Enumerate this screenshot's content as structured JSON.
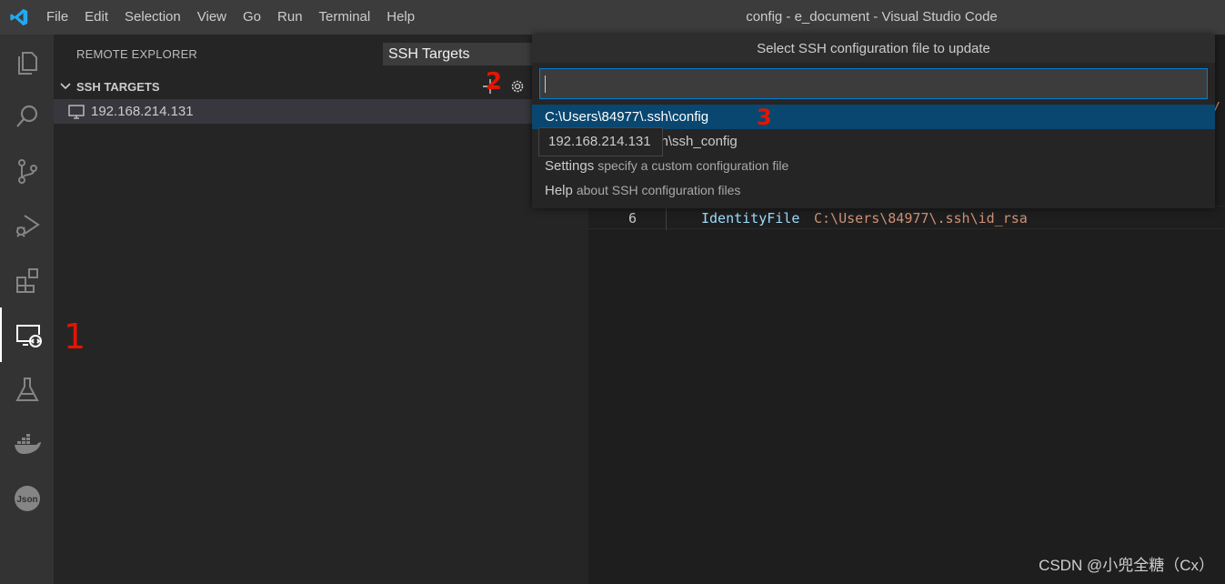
{
  "window": {
    "title": "config - e_document - Visual Studio Code"
  },
  "menubar": {
    "items": [
      "File",
      "Edit",
      "Selection",
      "View",
      "Go",
      "Run",
      "Terminal",
      "Help"
    ]
  },
  "activitybar": {
    "items": [
      "explorer-icon",
      "search-icon",
      "source-control-icon",
      "run-debug-icon",
      "extensions-icon",
      "remote-explorer-icon",
      "testing-icon",
      "docker-icon",
      "json-icon"
    ],
    "active": "remote-explorer-icon"
  },
  "sidebar": {
    "title": "REMOTE EXPLORER",
    "view_select": "SSH Targets",
    "section": {
      "label": "SSH TARGETS"
    },
    "targets": [
      {
        "label": "192.168.214.131",
        "icon": "monitor-icon"
      }
    ]
  },
  "editor": {
    "line_number": "6",
    "code_key": "IdentityFile",
    "code_value": "C:\\Users\\84977\\.ssh\\id_rsa",
    "stray_char": "/"
  },
  "quickpick": {
    "title": "Select SSH configuration file to update",
    "input_value": "",
    "items": [
      {
        "label": "C:\\Users\\84977\\.ssh\\config",
        "description": "",
        "selected": true
      },
      {
        "label": "C:\\ProgramData\\ssh\\ssh_config",
        "description": "",
        "selected": false
      },
      {
        "label": "Settings",
        "description": "specify a custom configuration file",
        "selected": false
      },
      {
        "label": "Help",
        "description": "about SSH configuration files",
        "selected": false
      }
    ]
  },
  "tooltip": {
    "text": "192.168.214.131"
  },
  "annotations": {
    "one": "1",
    "two": "2",
    "three": "3"
  },
  "watermark": "CSDN @小兜全糖（Cx）",
  "colors": {
    "accent": "#007fd4",
    "selection": "#094771",
    "annotation": "#e51400",
    "logo": "#23a9f2"
  }
}
